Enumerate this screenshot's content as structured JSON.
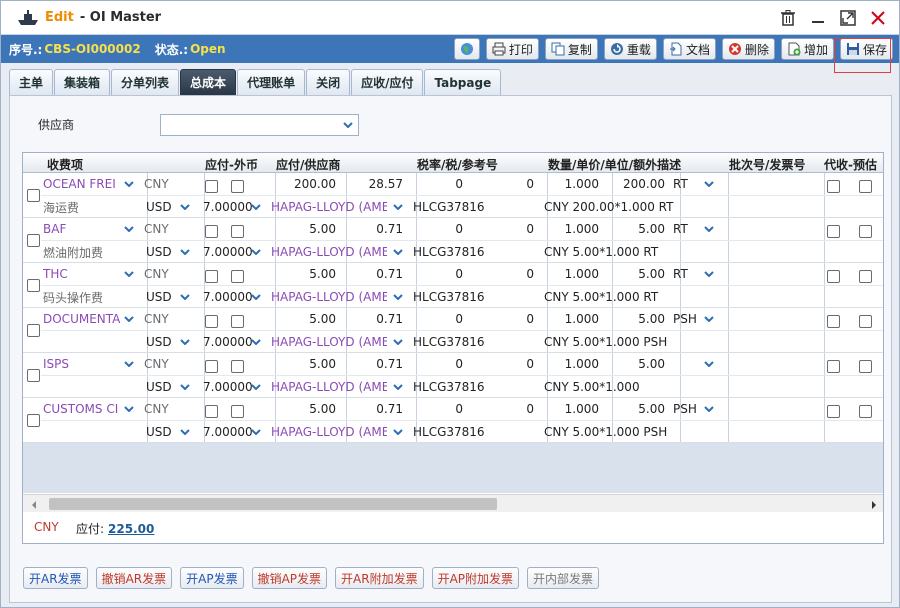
{
  "window": {
    "edit_label": "Edit",
    "title": "- OI Master"
  },
  "info": {
    "seq_label": "序号.:",
    "seq_value": "CBS-OI000002",
    "status_label": "状态.:",
    "status_value": "Open"
  },
  "toolbar": {
    "print": "打印",
    "copy": "复制",
    "reload": "重载",
    "docs": "文档",
    "delete": "删除",
    "add": "增加",
    "save": "保存"
  },
  "tabs": [
    "主单",
    "集装箱",
    "分单列表",
    "总成本",
    "代理账单",
    "关闭",
    "应收/应付",
    "Tabpage"
  ],
  "active_tab": "总成本",
  "filter": {
    "supplier_label": "供应商",
    "supplier_value": ""
  },
  "grid": {
    "headers": [
      "收费项",
      "应付-外币",
      "应付/供应商",
      "税率/税/参考号",
      "数量/单价/单位/额外描述",
      "批次号/发票号",
      "代收-预估"
    ],
    "rows": [
      {
        "charge": "OCEAN FREI",
        "charge_desc": "海运费",
        "currency": "CNY",
        "fx_currency": "USD",
        "fx_rate": "7.00000",
        "amount": "200.00",
        "amount2": "28.57",
        "supplier": "HAPAG-LLOYD (AME",
        "tax1": "0",
        "tax2": "0",
        "ref": "HLCG37816",
        "qty": "1.000",
        "price": "200.00",
        "unit": "RT",
        "desc": "CNY 200.00*1.000 RT"
      },
      {
        "charge": "BAF",
        "charge_desc": "燃油附加费",
        "currency": "CNY",
        "fx_currency": "USD",
        "fx_rate": "7.00000",
        "amount": "5.00",
        "amount2": "0.71",
        "supplier": "HAPAG-LLOYD (AME",
        "tax1": "0",
        "tax2": "0",
        "ref": "HLCG37816",
        "qty": "1.000",
        "price": "5.00",
        "unit": "RT",
        "desc": "CNY 5.00*1.000 RT"
      },
      {
        "charge": "THC",
        "charge_desc": "码头操作费",
        "currency": "CNY",
        "fx_currency": "USD",
        "fx_rate": "7.00000",
        "amount": "5.00",
        "amount2": "0.71",
        "supplier": "HAPAG-LLOYD (AME",
        "tax1": "0",
        "tax2": "0",
        "ref": "HLCG37816",
        "qty": "1.000",
        "price": "5.00",
        "unit": "RT",
        "desc": "CNY 5.00*1.000 RT"
      },
      {
        "charge": "DOCUMENTA",
        "charge_desc": "",
        "currency": "CNY",
        "fx_currency": "USD",
        "fx_rate": "7.00000",
        "amount": "5.00",
        "amount2": "0.71",
        "supplier": "HAPAG-LLOYD (AME",
        "tax1": "0",
        "tax2": "0",
        "ref": "HLCG37816",
        "qty": "1.000",
        "price": "5.00",
        "unit": "PSH",
        "desc": "CNY 5.00*1.000 PSH"
      },
      {
        "charge": "ISPS",
        "charge_desc": "",
        "currency": "CNY",
        "fx_currency": "USD",
        "fx_rate": "7.00000",
        "amount": "5.00",
        "amount2": "0.71",
        "supplier": "HAPAG-LLOYD (AME",
        "tax1": "0",
        "tax2": "0",
        "ref": "HLCG37816",
        "qty": "1.000",
        "price": "5.00",
        "unit": "",
        "desc": "CNY 5.00*1.000"
      },
      {
        "charge": "CUSTOMS CI",
        "charge_desc": "",
        "currency": "CNY",
        "fx_currency": "USD",
        "fx_rate": "7.00000",
        "amount": "5.00",
        "amount2": "0.71",
        "supplier": "HAPAG-LLOYD (AME",
        "tax1": "0",
        "tax2": "0",
        "ref": "HLCG37816",
        "qty": "1.000",
        "price": "5.00",
        "unit": "PSH",
        "desc": "CNY 5.00*1.000 PSH"
      }
    ]
  },
  "totals": {
    "currency": "CNY",
    "ap_label": "应付:",
    "ap_value": "225.00"
  },
  "bottom_buttons": [
    {
      "label": "开AR发票",
      "style": "blue"
    },
    {
      "label": "撤销AR发票",
      "style": "red"
    },
    {
      "label": "开AP发票",
      "style": "blue"
    },
    {
      "label": "撤销AP发票",
      "style": "red"
    },
    {
      "label": "开AR附加发票",
      "style": "red"
    },
    {
      "label": "开AP附加发票",
      "style": "red"
    },
    {
      "label": "开内部发票",
      "style": "grey"
    }
  ],
  "colors": {
    "accent": "#3d76b8",
    "highlight": "#f7e14a",
    "edit": "#f08c00",
    "purple_text": "#8a4bb5"
  }
}
